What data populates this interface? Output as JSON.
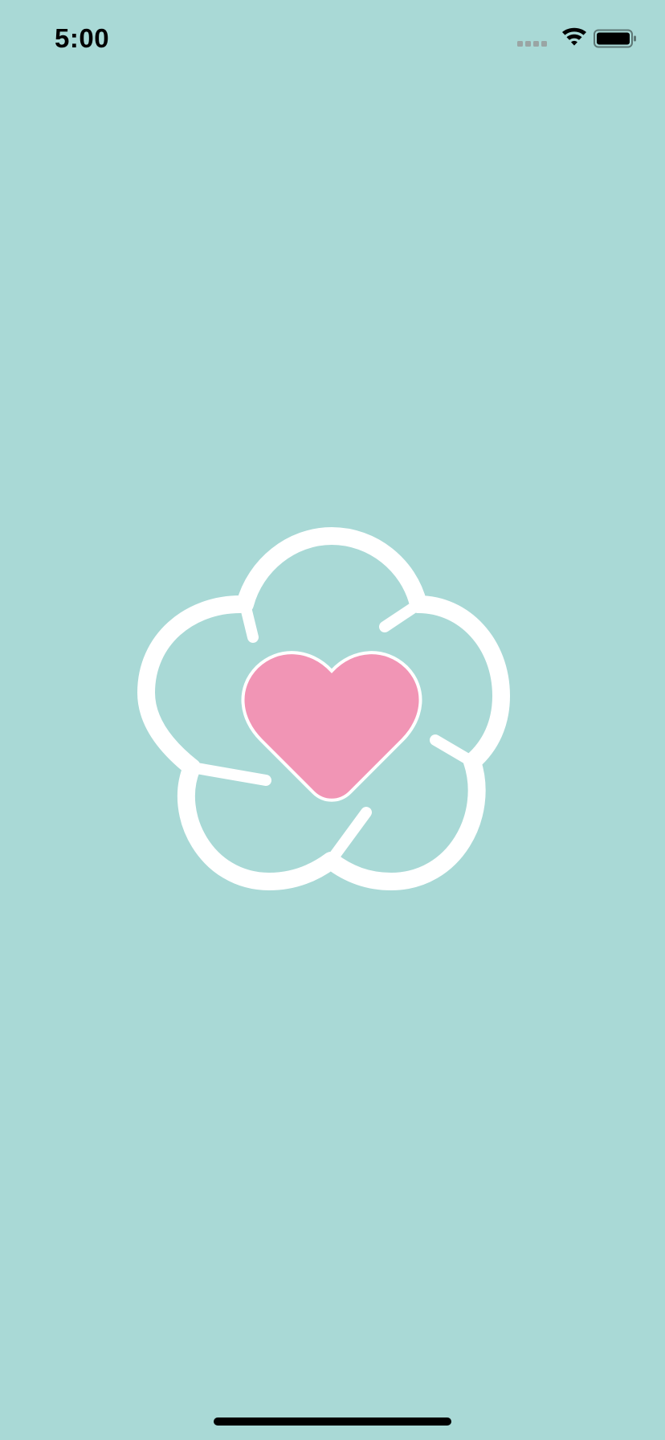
{
  "status_bar": {
    "time": "5:00",
    "signal_icon": "signal-dots-icon",
    "wifi_icon": "wifi-icon",
    "battery_icon": "battery-icon"
  },
  "splash": {
    "logo_icon": "flower-heart-logo-icon"
  },
  "colors": {
    "background": "#a9d9d6",
    "flower_outline": "#ffffff",
    "heart": "#f195b5"
  }
}
